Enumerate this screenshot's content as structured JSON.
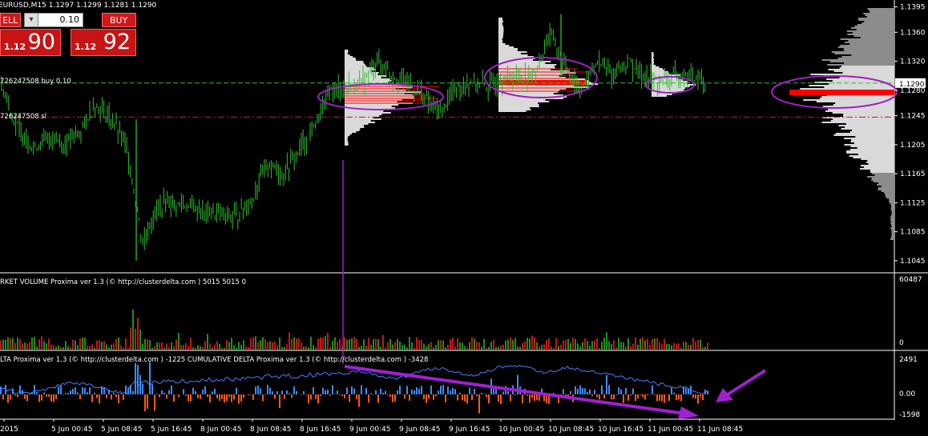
{
  "header": {
    "symbol_line": "EURUSD,M15  1.1297 1.1299 1.1281 1.1290"
  },
  "trade_panel": {
    "sell_label": "ELL",
    "buy_label": "BUY",
    "minus_label": "▾",
    "lot": "0.10",
    "sell_small": "1.12",
    "sell_big": "90",
    "buy_small": "1.12",
    "buy_big": "92"
  },
  "annotations": {
    "order_line": "726247508 buy 0.10",
    "sl_line": "726247508 sl",
    "volume_title": "RKET VOLUME Proxima ver 1.3 (© http://clusterdelta.com ) 5015 5015 0",
    "delta_title": "LTA Proxima ver 1.3 (© http://clusterdelta.com ) -1225  CUMULATIVE DELTA Proxima ver 1.3 (© http://clusterdelta.com ) -3428",
    "current_price_tag": "1.1290"
  },
  "colors": {
    "candle": "#2fbf2f",
    "bg": "#000000",
    "grid_label": "#ffffff",
    "profile_light": "#d9d9d9",
    "profile_dark": "#8c8c8c",
    "poc_red": "#ff0000",
    "ellipse": "#a020c0",
    "arrow": "#a020d0",
    "delta_pos": "#3a8cff",
    "delta_neg": "#ff5a1a",
    "volume_up": "#1f8f1f",
    "volume_down": "#c01818"
  },
  "chart_data": [
    {
      "type": "line",
      "name": "price",
      "y_ticks": [
        "1.1395",
        "1.1360",
        "1.1320",
        "1.1280",
        "1.1245",
        "1.1205",
        "1.1165",
        "1.1125",
        "1.1085",
        "1.1045"
      ],
      "x_ticks": [
        "2015",
        "5 Jun 00:45",
        "5 Jun 08:45",
        "5 Jun 16:45",
        "8 Jun 00:45",
        "8 Jun 08:45",
        "8 Jun 16:45",
        "9 Jun 00:45",
        "9 Jun 08:45",
        "9 Jun 16:45",
        "10 Jun 00:45",
        "10 Jun 08:45",
        "10 Jun 16:45",
        "11 Jun 00:45",
        "11 Jun 08:45"
      ],
      "ylim": [
        1.1035,
        1.141
      ],
      "current_price": 1.129,
      "buy_price": 1.129,
      "sl_price": 1.1243,
      "x": [
        0,
        20,
        40,
        60,
        80,
        100,
        120,
        140,
        160,
        170,
        180,
        200,
        220,
        240,
        260,
        280,
        300,
        320,
        340,
        360,
        380,
        400,
        420,
        440,
        460,
        480,
        500,
        520,
        540,
        560,
        580,
        600,
        620,
        640,
        660,
        680,
        700,
        720,
        740,
        760,
        780,
        800,
        820,
        840,
        860,
        880
      ],
      "y": [
        1.1285,
        1.123,
        1.12,
        1.1215,
        1.1205,
        1.1225,
        1.126,
        1.124,
        1.12,
        1.107,
        1.112,
        1.1125,
        1.112,
        1.111,
        1.111,
        1.1105,
        1.113,
        1.118,
        1.1165,
        1.12,
        1.123,
        1.128,
        1.1285,
        1.129,
        1.132,
        1.13,
        1.129,
        1.127,
        1.125,
        1.1285,
        1.129,
        1.1285,
        1.1295,
        1.13,
        1.13,
        1.136,
        1.131,
        1.128,
        1.132,
        1.13,
        1.132,
        1.13,
        1.129,
        1.13,
        1.13,
        1.129
      ]
    },
    {
      "type": "bar",
      "name": "market volume",
      "y_ticks": [
        "60487",
        "0"
      ],
      "ylim": [
        0,
        60487
      ]
    },
    {
      "type": "bar",
      "name": "delta",
      "y_ticks": [
        "2491",
        "0.00",
        "-1598"
      ],
      "ylim": [
        -1598,
        2491
      ]
    }
  ]
}
